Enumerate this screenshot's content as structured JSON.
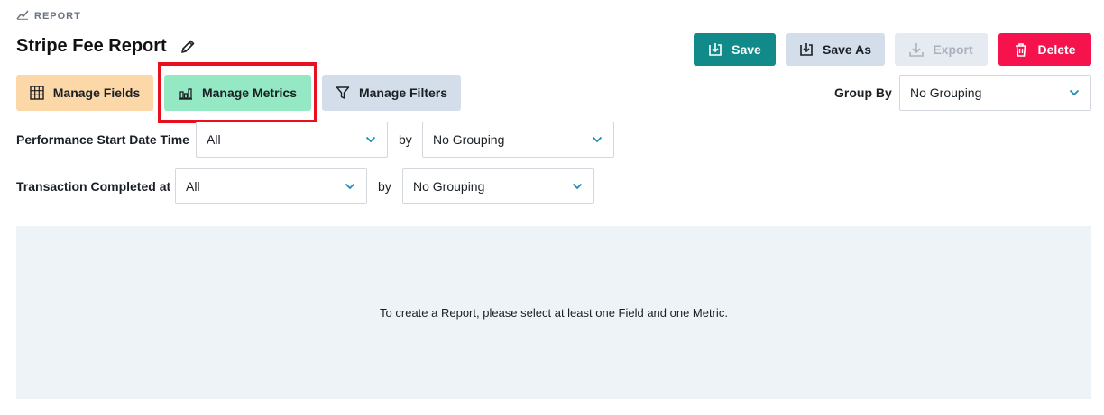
{
  "header": {
    "section_label": "REPORT",
    "title": "Stripe Fee Report"
  },
  "actions": {
    "save": "Save",
    "save_as": "Save As",
    "export": "Export",
    "delete": "Delete"
  },
  "toolbar": {
    "manage_fields": "Manage Fields",
    "manage_metrics": "Manage Metrics",
    "manage_filters": "Manage Filters"
  },
  "group_by": {
    "label": "Group By",
    "value": "No Grouping"
  },
  "date_filters": [
    {
      "label": "Performance Start Date Time",
      "range": "All",
      "by": "by",
      "grouping": "No Grouping"
    },
    {
      "label": "Transaction Completed at",
      "range": "All",
      "by": "by",
      "grouping": "No Grouping"
    }
  ],
  "empty_state": {
    "message": "To create a Report, please select at least one Field and one Metric."
  },
  "colors": {
    "save": "#138a8a",
    "delete": "#f5124d",
    "manage_fields": "#fcd7a8",
    "manage_metrics": "#94e8c4",
    "highlight": "#e8101f",
    "chevron": "#1a8fb5"
  }
}
